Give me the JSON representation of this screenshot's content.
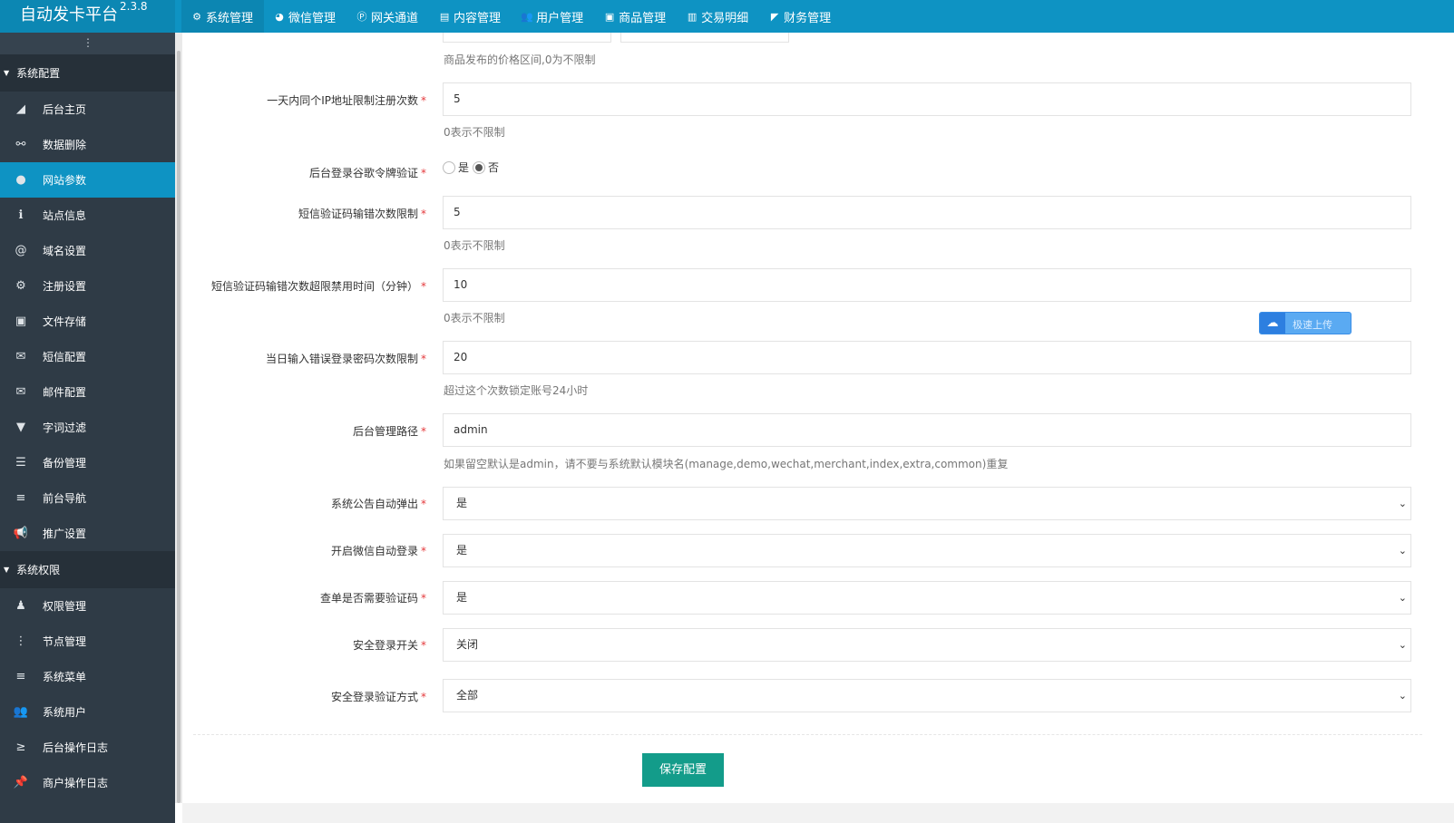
{
  "brand": {
    "name": "自动发卡平台",
    "version": "2.3.8"
  },
  "topnav": [
    {
      "label": "系统管理",
      "icon": "gear-icon",
      "glyph": "⚙",
      "active": true
    },
    {
      "label": "微信管理",
      "icon": "wechat-icon",
      "glyph": "◕",
      "active": false
    },
    {
      "label": "网关通道",
      "icon": "paypal-icon",
      "glyph": "Ⓟ",
      "active": false
    },
    {
      "label": "内容管理",
      "icon": "file-icon",
      "glyph": "▤",
      "active": false
    },
    {
      "label": "用户管理",
      "icon": "users-icon",
      "glyph": "👥",
      "active": false
    },
    {
      "label": "商品管理",
      "icon": "shopping-bag-icon",
      "glyph": "▣",
      "active": false
    },
    {
      "label": "交易明细",
      "icon": "bar-chart-icon",
      "glyph": "▥",
      "active": false
    },
    {
      "label": "财务管理",
      "icon": "wallet-icon",
      "glyph": "◤",
      "active": false
    }
  ],
  "sidebar": {
    "toggle_glyph": "⋮",
    "group1": {
      "label": "系统配置"
    },
    "items1": [
      {
        "label": "后台主页",
        "icon": "area-chart-icon",
        "glyph": "◢",
        "active": false
      },
      {
        "label": "数据删除",
        "icon": "link-icon",
        "glyph": "⚯",
        "active": false
      },
      {
        "label": "网站参数",
        "icon": "apple-icon",
        "glyph": "●",
        "active": true
      },
      {
        "label": "站点信息",
        "icon": "info-icon",
        "glyph": "ℹ",
        "active": false
      },
      {
        "label": "域名设置",
        "icon": "at-icon",
        "glyph": "@",
        "active": false
      },
      {
        "label": "注册设置",
        "icon": "gear-icon",
        "glyph": "⚙",
        "active": false
      },
      {
        "label": "文件存储",
        "icon": "save-icon",
        "glyph": "▣",
        "active": false
      },
      {
        "label": "短信配置",
        "icon": "envelope-icon",
        "glyph": "✉",
        "active": false
      },
      {
        "label": "邮件配置",
        "icon": "envelope-icon",
        "glyph": "✉",
        "active": false
      },
      {
        "label": "字词过滤",
        "icon": "filter-icon",
        "glyph": "▼",
        "active": false
      },
      {
        "label": "备份管理",
        "icon": "database-icon",
        "glyph": "☰",
        "active": false
      },
      {
        "label": "前台导航",
        "icon": "bars-icon",
        "glyph": "≡",
        "active": false
      },
      {
        "label": "推广设置",
        "icon": "bullhorn-icon",
        "glyph": "📢",
        "active": false
      }
    ],
    "group2": {
      "label": "系统权限"
    },
    "items2": [
      {
        "label": "权限管理",
        "icon": "user-secret-icon",
        "glyph": "♟",
        "active": false
      },
      {
        "label": "节点管理",
        "icon": "ellipsis-vertical-icon",
        "glyph": "⋮",
        "active": false
      },
      {
        "label": "系统菜单",
        "icon": "bars-icon",
        "glyph": "≡",
        "active": false
      },
      {
        "label": "系统用户",
        "icon": "users-icon",
        "glyph": "👥",
        "active": false
      },
      {
        "label": "后台操作日志",
        "icon": "terminal-icon",
        "glyph": "≥",
        "active": false
      },
      {
        "label": "商户操作日志",
        "icon": "thumbtack-icon",
        "glyph": "📌",
        "active": false
      }
    ]
  },
  "form": {
    "price_help": "商品发布的价格区间,0为不限制",
    "ip_limit": {
      "label": "一天内同个IP地址限制注册次数",
      "value": "5",
      "help": "0表示不限制"
    },
    "google_auth": {
      "label": "后台登录谷歌令牌验证",
      "opt_yes": "是",
      "opt_no": "否",
      "selected": "否"
    },
    "sms_error_limit": {
      "label": "短信验证码输错次数限制",
      "value": "5",
      "help": "0表示不限制"
    },
    "sms_ban_minutes": {
      "label": "短信验证码输错次数超限禁用时间（分钟）",
      "value": "10",
      "help": "0表示不限制"
    },
    "login_error_limit": {
      "label": "当日输入错误登录密码次数限制",
      "value": "20",
      "help": "超过这个次数锁定账号24小时"
    },
    "admin_path": {
      "label": "后台管理路径",
      "value": "admin",
      "help": "如果留空默认是admin，请不要与系统默认模块名(manage,demo,wechat,merchant,index,extra,common)重复"
    },
    "notice_popup": {
      "label": "系统公告自动弹出",
      "value": "是"
    },
    "wechat_login": {
      "label": "开启微信自动登录",
      "value": "是"
    },
    "order_captcha": {
      "label": "查单是否需要验证码",
      "value": "是"
    },
    "safe_login": {
      "label": "安全登录开关",
      "value": "关闭"
    },
    "safe_login_method": {
      "label": "安全登录验证方式",
      "value": "全部"
    },
    "save_label": "保存配置",
    "required_mark": "*",
    "select_arrow": "⌄"
  },
  "upload_widget": {
    "label": "极速上传",
    "icon": "cloud-upload-icon",
    "glyph": "☁"
  }
}
